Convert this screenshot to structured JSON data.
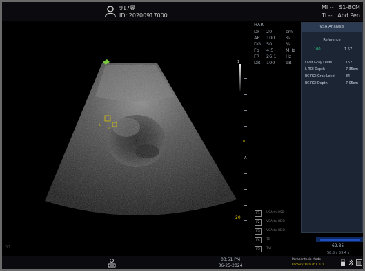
{
  "patient": {
    "name": "917晏",
    "id": "ID: 20200917000"
  },
  "header": {
    "mi": "MI --   S1-8CM",
    "ti": "TI --   Abd Pen"
  },
  "params": {
    "header": "HAR",
    "rows": [
      {
        "k": "DF",
        "v": "20",
        "u": "cm"
      },
      {
        "k": "AP",
        "v": "100",
        "u": "%"
      },
      {
        "k": "DG",
        "v": "50",
        "u": "%"
      },
      {
        "k": "Fq",
        "v": "4.5",
        "u": "MHz"
      },
      {
        "k": "FR",
        "v": "26.1",
        "u": "Hz"
      },
      {
        "k": "DR",
        "v": "100",
        "u": "dB"
      }
    ]
  },
  "depth_scale": {
    "top": "1",
    "mid": "10",
    "mid2": "A",
    "bottom": "20"
  },
  "analysis": {
    "title": "VSA Analysis",
    "reference_label": "Reference",
    "reference_a": "100",
    "reference_b": "1.57",
    "rows": [
      {
        "label": "Liver Gray Level",
        "value": "152"
      },
      {
        "label": "L ROI Depth",
        "value": "7.35cm"
      },
      {
        "label": "RC ROI Gray Level",
        "value": "84"
      },
      {
        "label": "RC ROI Depth",
        "value": "7.05cm"
      }
    ]
  },
  "presets": [
    {
      "key": "F1",
      "label": "VSA to USB"
    },
    {
      "key": "F2",
      "label": "VSA to HDD"
    },
    {
      "key": "F3",
      "label": "VSA to HDD"
    },
    {
      "key": "F4",
      "label": "TB"
    },
    {
      "key": "F5",
      "label": "TVI"
    }
  ],
  "probe": {
    "value": "62.85",
    "value2": "58.5 s 59.4 s"
  },
  "status": {
    "time": "03:51 PM",
    "date": "06-25-2024",
    "mode": "Paracentesis Mode",
    "firmware": "FactoryDefault 1.0.0",
    "corner": "51"
  },
  "colors": {
    "accent": "#2fd28a",
    "yellow": "#d9c100",
    "panel": "#1c2533"
  },
  "icons": [
    "patient-icon",
    "usb-icon",
    "bluetooth-icon",
    "settings-icon",
    "scan-icon"
  ]
}
